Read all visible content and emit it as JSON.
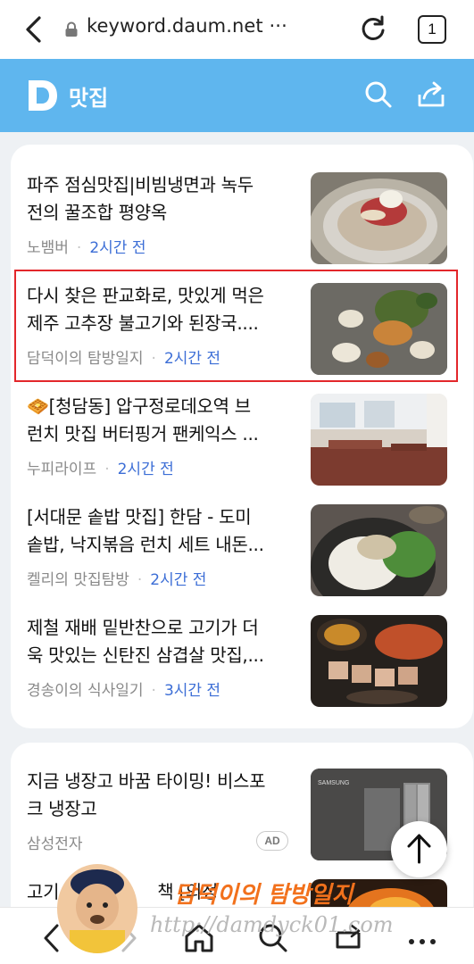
{
  "browser": {
    "url": "keyword.daum.net ···",
    "tab_count": "1"
  },
  "header": {
    "logo_letter": "D",
    "title": "맛집"
  },
  "articles": [
    {
      "title_lines": [
        "파주 점심맛집|비빔냉면과 녹두",
        "전의 꿀조합 평양옥"
      ],
      "source": "노뱀버",
      "time": "2시간 전"
    },
    {
      "title_lines": [
        "다시 찾은 판교화로, 맛있게 먹은",
        "제주 고추장 불고기와 된장국...."
      ],
      "source": "담덕이의 탐방일지",
      "time": "2시간 전"
    },
    {
      "title_lines": [
        "🧇[청담동] 압구정로데오역 브",
        "런치 맛집 버터핑거 팬케익스 ..."
      ],
      "source": "누피라이프",
      "time": "2시간 전"
    },
    {
      "title_lines": [
        "[서대문 솥밥 맛집] 한담 - 도미",
        "솥밥, 낙지볶음 런치 세트 내돈..."
      ],
      "source": "켈리의 맛집탐방",
      "time": "2시간 전"
    },
    {
      "title_lines": [
        "제철 재배 밑반찬으로 고기가 더",
        "욱 맛있는 신탄진 삼겹살 맛집,..."
      ],
      "source": "경송이의 식사일기",
      "time": "3시간 전"
    }
  ],
  "ad": {
    "title_lines": [
      "지금 냉장고 바꿈 타이밍! 비스포",
      "크 냉장고"
    ],
    "source": "삼성전자",
    "badge": "AD",
    "thumb_brand": "SAMSUNG"
  },
  "partial_item": {
    "title_start": "고기",
    "title_mid": "책 [의정"
  },
  "watermark": {
    "title": "담덕이의 탐방일지",
    "url": "http://damdyck01.com"
  },
  "colors": {
    "daum_blue": "#5fb6ee",
    "time_blue": "#3c6ed6",
    "highlight_red": "#e3272b",
    "watermark_orange": "#f2711c"
  },
  "icons": [
    "back-icon",
    "lock-icon",
    "reload-icon",
    "search-icon",
    "share-icon",
    "arrow-up-icon",
    "home-icon",
    "tabs-icon",
    "more-icon"
  ]
}
